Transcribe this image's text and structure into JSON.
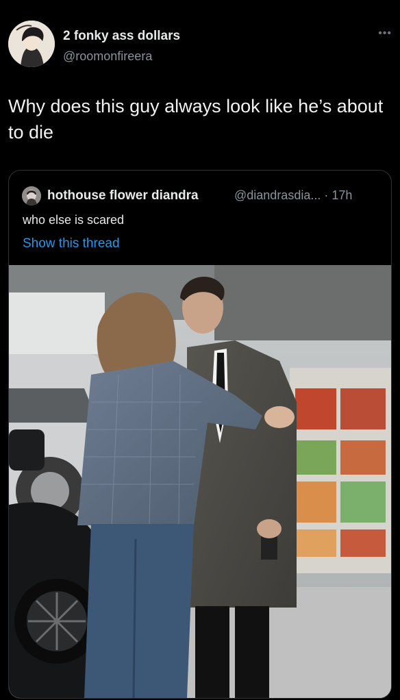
{
  "tweet": {
    "author_name": "2 fonky ass dollars",
    "author_handle": "@roomonfireera",
    "more_icon": "more-horizontal-icon",
    "text": "Why does this guy always look like he’s about to die"
  },
  "quoted_tweet": {
    "author_name": "hothouse flower diandra",
    "author_handle_time": "@diandrasdia... · 17h",
    "text": "who else is scared",
    "thread_link": "Show this thread",
    "link_color": "#1d9bf0"
  },
  "colors": {
    "background": "#000000",
    "primary_text": "#e7e9ea",
    "secondary_text": "#8b949b",
    "border": "#2f3336"
  }
}
